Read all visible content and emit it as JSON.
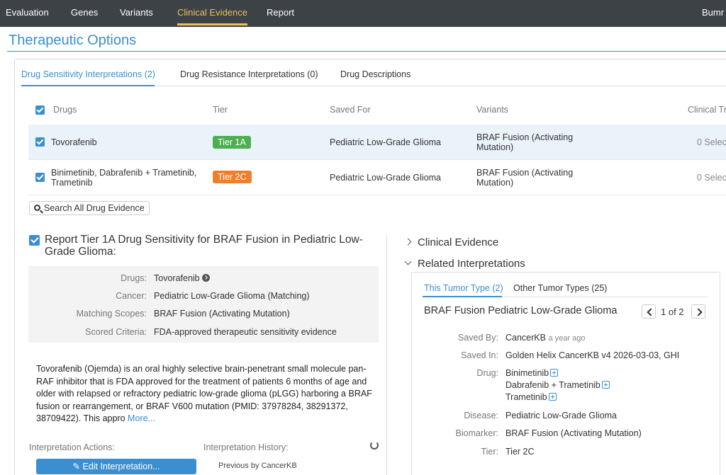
{
  "nav": {
    "items": [
      "Evaluation",
      "Genes",
      "Variants",
      "Clinical Evidence",
      "Report"
    ],
    "active": "Clinical Evidence",
    "user": "Bumr"
  },
  "page": {
    "title": "Therapeutic Options"
  },
  "tabs": [
    {
      "label": "Drug Sensitivity Interpretations (2)",
      "active": true
    },
    {
      "label": "Drug Resistance Interpretations (0)",
      "active": false
    },
    {
      "label": "Drug Descriptions",
      "active": false
    }
  ],
  "table": {
    "headers": [
      "Drugs",
      "Tier",
      "Saved For",
      "Variants",
      "Clinical Tri"
    ],
    "rows": [
      {
        "drugs": "Tovorafenib",
        "tier": "Tier 1A",
        "tier_color": "#4caf50",
        "saved_for": "Pediatric Low-Grade Glioma",
        "variants": "BRAF Fusion (Activating Mutation)",
        "trials": "0 Selec",
        "selected": true
      },
      {
        "drugs": "Binimetinib, Dabrafenib + Trametinib, Trametinib",
        "tier": "Tier 2C",
        "tier_color": "#f07f2c",
        "saved_for": "Pediatric Low-Grade Glioma",
        "variants": "BRAF Fusion (Activating Mutation)",
        "trials": "0 Selec",
        "selected": false
      }
    ]
  },
  "search_button": "Search All Drug Evidence",
  "report": {
    "title": "Report Tier 1A Drug Sensitivity for BRAF Fusion in Pediatric Low-Grade Glioma:",
    "details": [
      {
        "label": "Drugs:",
        "value": "Tovorafenib"
      },
      {
        "label": "Cancer:",
        "value": "Pediatric Low-Grade Glioma (Matching)"
      },
      {
        "label": "Matching Scopes:",
        "value": "BRAF Fusion (Activating Mutation)"
      },
      {
        "label": "Scored Criteria:",
        "value": "FDA-approved therapeutic sensitivity evidence"
      }
    ],
    "description": "Tovorafenib (Ojemda) is an oral highly selective brain-penetrant small molecule pan-RAF inhibitor that is FDA approved for the treatment of patients 6 months of age and older with relapsed or refractory pediatric low-grade glioma (pLGG) harboring a BRAF fusion or rearrangement, or BRAF V600 mutation (PMID: 37978284, 38291372, 38709422).  This appro",
    "more_link": "More...",
    "actions_label": "Interpretation Actions:",
    "history_label": "Interpretation History:",
    "edit_button": "Edit Interpretation...",
    "history_note": "Previous by CancerKB"
  },
  "right": {
    "clinical_evidence_label": "Clinical Evidence",
    "related_label": "Related Interpretations",
    "tabs": [
      {
        "label": "This Tumor Type (2)",
        "active": true
      },
      {
        "label": "Other Tumor Types (25)",
        "active": false
      }
    ],
    "title": "BRAF Fusion Pediatric Low-Grade Glioma",
    "pager": "1 of 2",
    "saved_by": {
      "label": "Saved By:",
      "value": "CancerKB",
      "when": "a year ago"
    },
    "saved_in": {
      "label": "Saved In:",
      "value": "Golden Helix CancerKB v4 2026-03-03, GHI"
    },
    "drug": {
      "label": "Drug:",
      "values": [
        "Binimetinib",
        "Dabrafenib + Trametinib",
        "Trametinib"
      ]
    },
    "disease": {
      "label": "Disease:",
      "value": "Pediatric Low-Grade Glioma"
    },
    "biomarker": {
      "label": "Biomarker:",
      "value": "BRAF Fusion (Activating Mutation)"
    },
    "tier": {
      "label": "Tier:",
      "value": "Tier 2C"
    }
  }
}
